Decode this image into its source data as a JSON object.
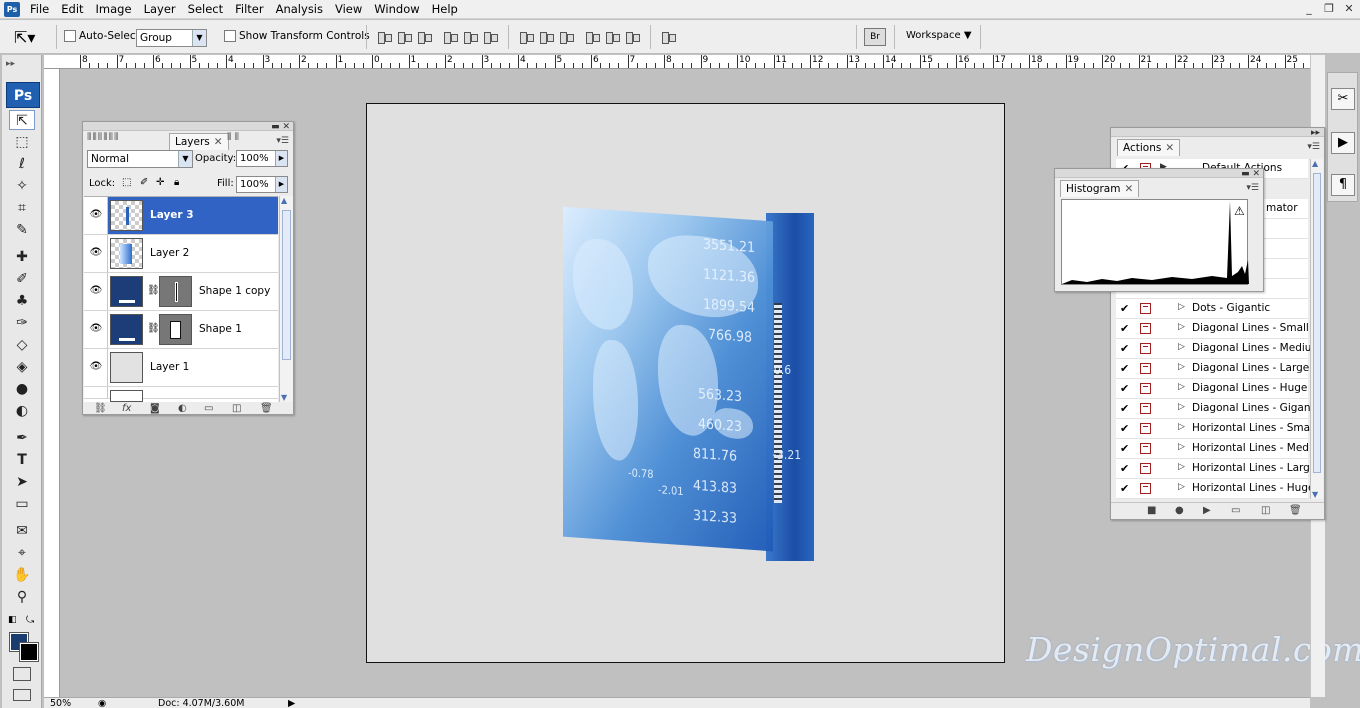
{
  "app": {
    "icon_label": "Ps"
  },
  "menu": [
    "File",
    "Edit",
    "Image",
    "Layer",
    "Select",
    "Filter",
    "Analysis",
    "View",
    "Window",
    "Help"
  ],
  "window_buttons": [
    "_",
    "❐",
    "✕"
  ],
  "options_bar": {
    "auto_select_label": "Auto-Select:",
    "auto_select_value": "Group",
    "show_transform_label": "Show Transform Controls",
    "workspace_label": "Workspace"
  },
  "ruler_top_labels": [
    "8",
    "7",
    "6",
    "5",
    "4",
    "3",
    "2",
    "1",
    "0",
    "1",
    "2",
    "3",
    "4",
    "5",
    "6",
    "7",
    "8",
    "9",
    "10",
    "11",
    "12",
    "13",
    "14",
    "15",
    "16",
    "17",
    "18",
    "19",
    "20",
    "21",
    "22",
    "23",
    "24",
    "25"
  ],
  "toolbox": {
    "logo": "Ps",
    "tools": [
      "move-tool",
      "marquee-tool",
      "lasso-tool",
      "magic-wand-tool",
      "crop-tool",
      "eyedropper-tool",
      "healing-brush-tool",
      "brush-tool",
      "clone-stamp-tool",
      "history-brush-tool",
      "eraser-tool",
      "paint-bucket-tool",
      "blur-tool",
      "dodge-tool",
      "pen-tool",
      "type-tool",
      "path-selection-tool",
      "shape-tool",
      "notes-tool",
      "eyedropper-3d-tool",
      "hand-tool",
      "zoom-tool"
    ],
    "colors": {
      "foreground": "#1b3c6e",
      "background": "#000000"
    }
  },
  "layers_panel": {
    "tab_label": "Layers",
    "blend_mode": "Normal",
    "opacity_label": "Opacity:",
    "opacity_value": "100%",
    "lock_label": "Lock:",
    "fill_label": "Fill:",
    "fill_value": "100%",
    "layers": [
      {
        "name": "Layer 3",
        "selected": true
      },
      {
        "name": "Layer 2",
        "selected": false
      },
      {
        "name": "Shape 1 copy",
        "selected": false
      },
      {
        "name": "Shape 1",
        "selected": false
      },
      {
        "name": "Layer 1",
        "selected": false
      }
    ]
  },
  "actions_panel": {
    "tab_label": "Actions",
    "set_name": "Default Actions",
    "partial_item": "mator",
    "items": [
      "Dots - Gigantic",
      "Diagonal Lines - Small",
      "Diagonal Lines - Medium",
      "Diagonal Lines - Large",
      "Diagonal Lines - Huge",
      "Diagonal Lines - Gigan...",
      "Horizontal Lines - Small",
      "Horizontal Lines - Med...",
      "Horizontal Lines - Large",
      "Horizontal Lines - Huge"
    ]
  },
  "histogram_panel": {
    "tab_label": "Histogram"
  },
  "artwork_numbers": [
    "3551.21",
    "1121.36",
    "1899.54",
    "766.98",
    "563.23",
    "460.23",
    "811.76",
    "413.83",
    "312.33",
    "-0.6",
    "+3.21",
    "-0.78",
    "-2.01"
  ],
  "status_bar": {
    "zoom": "50%",
    "doc": "Doc: 4.07M/3.60M"
  },
  "watermark": "DesignOptimal.com",
  "accent_color": "#3163c5"
}
